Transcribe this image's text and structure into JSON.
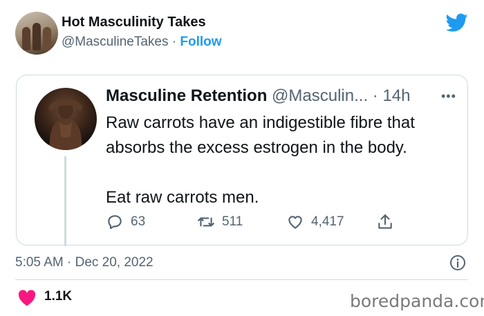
{
  "tweet": {
    "author_name": "Hot Masculinity Takes",
    "author_handle": "@MasculineTakes",
    "separator": " · ",
    "follow_label": "Follow",
    "timestamp": "5:05 AM · Dec 20, 2022",
    "likes_count": "1.1K"
  },
  "quoted_tweet": {
    "author_name": "Masculine Retention",
    "author_handle": "@Masculin...",
    "time_ago": "· 14h",
    "text_line_1": "Raw carrots have an indigestible fibre that",
    "text_line_2": "absorbs the excess estrogen in the body.",
    "text_line_3": "Eat raw carrots men.",
    "replies": "63",
    "retweets": "511",
    "likes": "4,417"
  },
  "icons": {
    "brand": "twitter-bird-icon",
    "more": "more-dots-icon",
    "reply": "reply-icon",
    "retweet": "retweet-icon",
    "like": "like-icon",
    "share": "share-icon",
    "info": "info-icon",
    "heart": "heart-icon"
  },
  "colors": {
    "accent": "#1d9bf0",
    "heart": "#f91880",
    "muted": "#536471",
    "border": "#cfd9de"
  },
  "watermark": "boredpanda.com"
}
